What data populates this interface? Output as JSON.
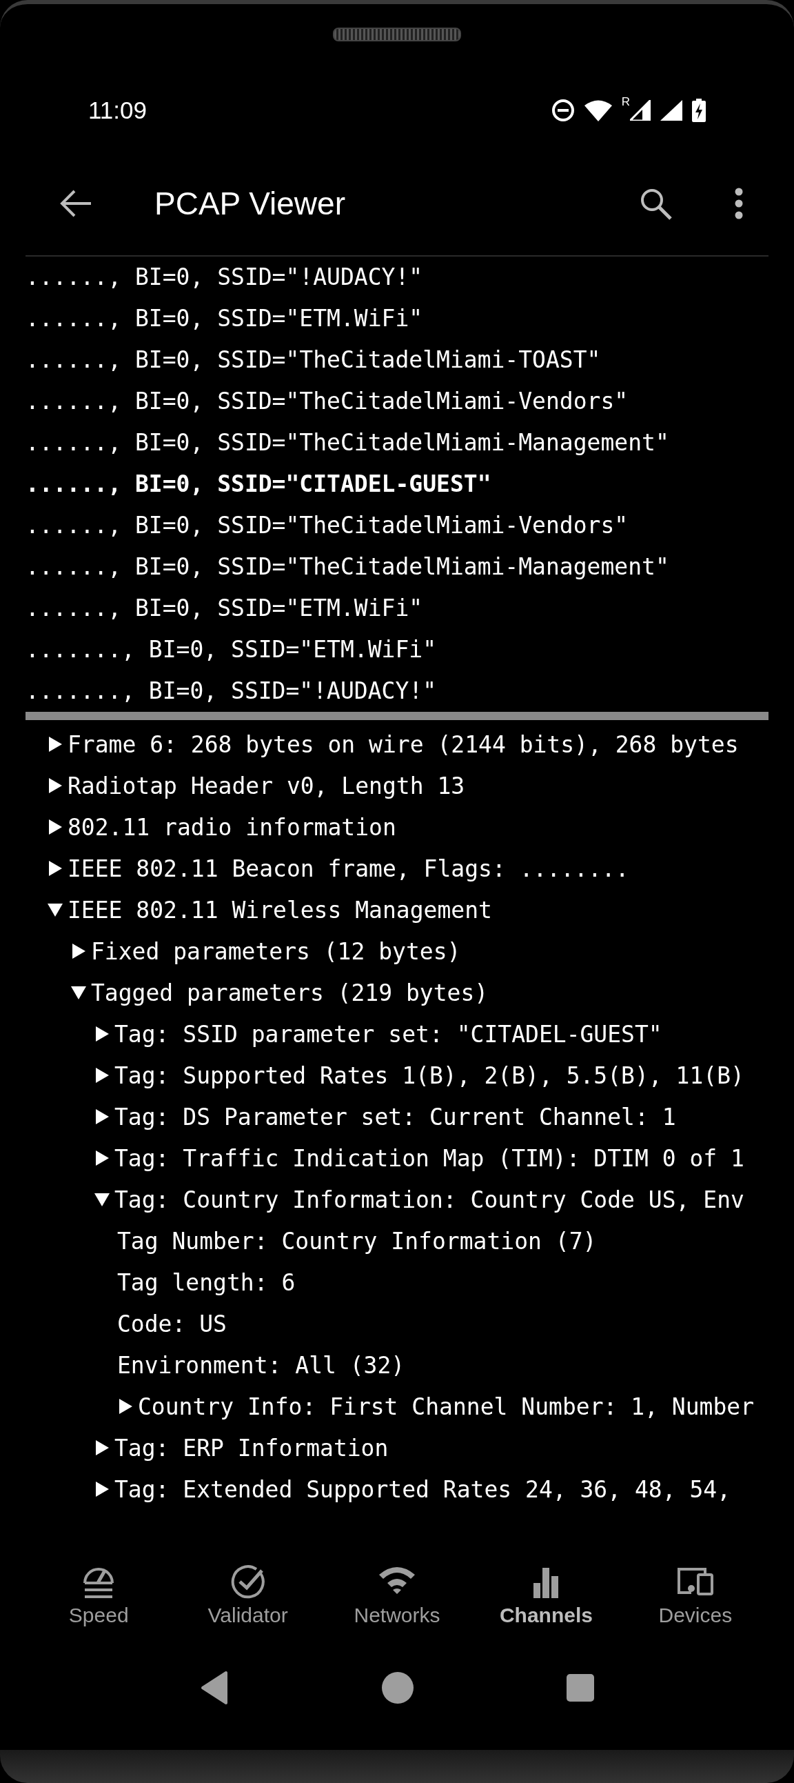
{
  "status_bar": {
    "time": "11:09",
    "roaming_label": "R"
  },
  "app_bar": {
    "title": "PCAP Viewer"
  },
  "packets": [
    {
      "text": "......, BI=0, SSID=\"!AUDACY!\"",
      "selected": false
    },
    {
      "text": "......, BI=0, SSID=\"ETM.WiFi\"",
      "selected": false
    },
    {
      "text": "......, BI=0, SSID=\"TheCitadelMiami-TOAST\"",
      "selected": false
    },
    {
      "text": "......, BI=0, SSID=\"TheCitadelMiami-Vendors\"",
      "selected": false
    },
    {
      "text": "......, BI=0, SSID=\"TheCitadelMiami-Management\"",
      "selected": false
    },
    {
      "text": "......, BI=0, SSID=\"CITADEL-GUEST\"",
      "selected": true
    },
    {
      "text": "......, BI=0, SSID=\"TheCitadelMiami-Vendors\"",
      "selected": false
    },
    {
      "text": "......, BI=0, SSID=\"TheCitadelMiami-Management\"",
      "selected": false
    },
    {
      "text": "......, BI=0, SSID=\"ETM.WiFi\"",
      "selected": false
    },
    {
      "text": "......., BI=0, SSID=\"ETM.WiFi\"",
      "selected": false
    },
    {
      "text": "......., BI=0, SSID=\"!AUDACY!\"",
      "selected": false
    }
  ],
  "details": [
    {
      "kind": "branch",
      "expanded": false,
      "text": "Frame 6: 268 bytes on wire (2144 bits), 268 bytes"
    },
    {
      "kind": "branch",
      "expanded": false,
      "text": "Radiotap Header v0, Length 13"
    },
    {
      "kind": "branch",
      "expanded": false,
      "text": "802.11 radio information"
    },
    {
      "kind": "branch",
      "expanded": false,
      "text": "IEEE 802.11 Beacon frame, Flags: ........"
    },
    {
      "kind": "branch",
      "expanded": true,
      "text": "IEEE 802.11 Wireless Management",
      "children": [
        {
          "kind": "branch",
          "expanded": false,
          "text": "Fixed parameters (12 bytes)"
        },
        {
          "kind": "branch",
          "expanded": true,
          "text": "Tagged parameters (219 bytes)",
          "children": [
            {
              "kind": "branch",
              "expanded": false,
              "text": "Tag: SSID parameter set: \"CITADEL-GUEST\""
            },
            {
              "kind": "branch",
              "expanded": false,
              "text": "Tag: Supported Rates 1(B), 2(B), 5.5(B), 11(B)"
            },
            {
              "kind": "branch",
              "expanded": false,
              "text": "Tag: DS Parameter set: Current Channel: 1"
            },
            {
              "kind": "branch",
              "expanded": false,
              "text": "Tag: Traffic Indication Map (TIM): DTIM 0 of 1"
            },
            {
              "kind": "branch",
              "expanded": true,
              "text": "Tag: Country Information: Country Code US, Env",
              "children": [
                {
                  "kind": "leaf",
                  "text": "Tag Number: Country Information (7)"
                },
                {
                  "kind": "leaf",
                  "text": "Tag length: 6"
                },
                {
                  "kind": "leaf",
                  "text": "Code: US"
                },
                {
                  "kind": "leaf",
                  "text": "Environment: All (32)"
                },
                {
                  "kind": "branch",
                  "expanded": false,
                  "text": "Country Info: First Channel Number: 1, Number"
                }
              ]
            },
            {
              "kind": "branch",
              "expanded": false,
              "text": "Tag: ERP Information"
            },
            {
              "kind": "branch",
              "expanded": false,
              "text": "Tag: Extended Supported Rates 24, 36, 48, 54,"
            }
          ]
        }
      ]
    }
  ],
  "bottom_nav": [
    {
      "kind": "speed",
      "label": "Speed",
      "selected": false
    },
    {
      "kind": "validator",
      "label": "Validator",
      "selected": false
    },
    {
      "kind": "wifi",
      "label": "Networks",
      "selected": false
    },
    {
      "kind": "chart",
      "label": "Channels",
      "selected": true
    },
    {
      "kind": "devices",
      "label": "Devices",
      "selected": false
    }
  ]
}
